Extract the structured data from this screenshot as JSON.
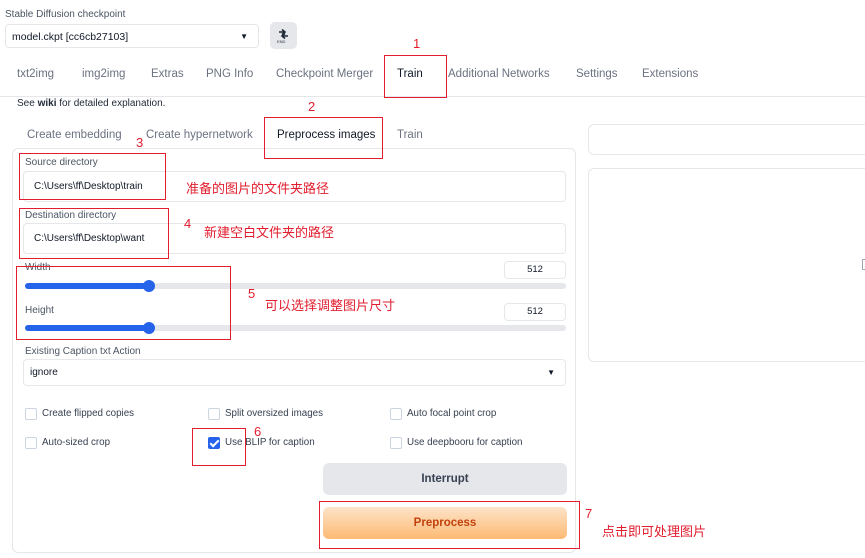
{
  "checkpoint": {
    "label": "Stable Diffusion checkpoint",
    "value": "model.ckpt [cc6cb27103]",
    "refresh_icon_text": "END"
  },
  "tabs": [
    {
      "label": "txt2img"
    },
    {
      "label": "img2img"
    },
    {
      "label": "Extras"
    },
    {
      "label": "PNG Info"
    },
    {
      "label": "Checkpoint Merger"
    },
    {
      "label": "Train"
    },
    {
      "label": "Additional Networks"
    },
    {
      "label": "Settings"
    },
    {
      "label": "Extensions"
    }
  ],
  "help": {
    "prefix": "See ",
    "link": "wiki",
    "suffix": " for detailed explanation."
  },
  "subtabs": [
    {
      "label": "Create embedding"
    },
    {
      "label": "Create hypernetwork"
    },
    {
      "label": "Preprocess images"
    },
    {
      "label": "Train"
    }
  ],
  "source": {
    "label": "Source directory",
    "value": "C:\\Users\\ff\\Desktop\\train"
  },
  "destination": {
    "label": "Destination directory",
    "value": "C:\\Users\\ff\\Desktop\\want"
  },
  "width": {
    "label": "Width",
    "value": "512",
    "slider_fraction": 0.23
  },
  "height": {
    "label": "Height",
    "value": "512",
    "slider_fraction": 0.23
  },
  "caption_action": {
    "label": "Existing Caption txt Action",
    "value": "ignore"
  },
  "checkboxes": [
    {
      "label": "Create flipped copies",
      "checked": false
    },
    {
      "label": "Split oversized images",
      "checked": false
    },
    {
      "label": "Auto focal point crop",
      "checked": false
    },
    {
      "label": "Auto-sized crop",
      "checked": false
    },
    {
      "label": "Use BLIP for caption",
      "checked": true
    },
    {
      "label": "Use deepbooru for caption",
      "checked": false
    }
  ],
  "buttons": {
    "interrupt": "Interrupt",
    "preprocess": "Preprocess"
  },
  "annotations": {
    "n1": "1",
    "n2": "2",
    "n3": "3",
    "n4": "4",
    "n5": "5",
    "n6": "6",
    "n7": "7",
    "note_source": "准备的图片的文件夹路径",
    "note_dest": "新建空白文件夹的路径",
    "note_size": "可以选择调整图片尺寸",
    "note_process": "点击即可处理图片",
    "color": "#e11d2e"
  },
  "colors": {
    "accent": "#2563eb",
    "preprocess_text": "#c2410c"
  }
}
